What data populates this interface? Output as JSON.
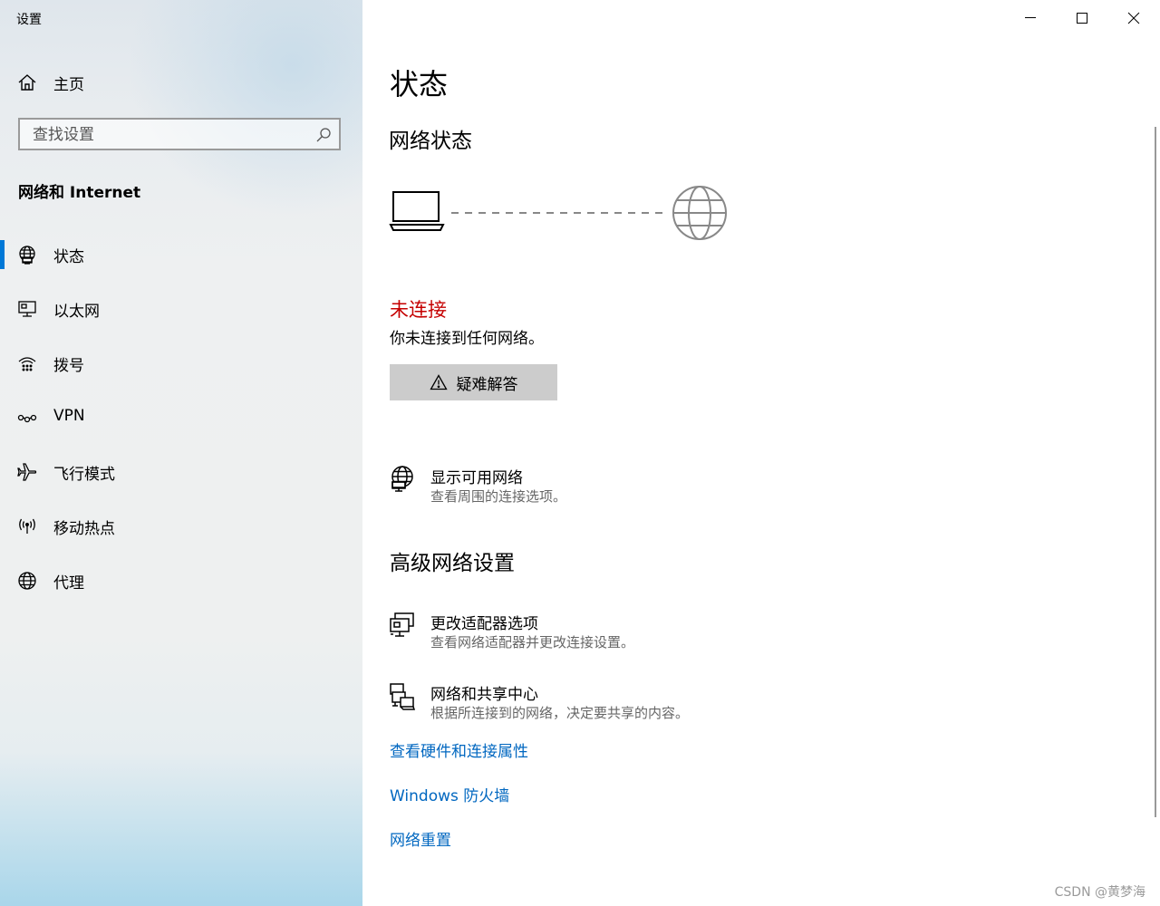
{
  "window": {
    "title": "设置"
  },
  "sidebar": {
    "home_label": "主页",
    "search_placeholder": "查找设置",
    "section_header": "网络和 Internet",
    "items": [
      {
        "label": "状态",
        "icon": "globe-status-icon",
        "active": true
      },
      {
        "label": "以太网",
        "icon": "ethernet-icon"
      },
      {
        "label": "拨号",
        "icon": "dialup-icon"
      },
      {
        "label": "VPN",
        "icon": "vpn-icon"
      },
      {
        "label": "飞行模式",
        "icon": "airplane-icon"
      },
      {
        "label": "移动热点",
        "icon": "hotspot-icon"
      },
      {
        "label": "代理",
        "icon": "globe-icon"
      }
    ]
  },
  "main": {
    "page_title": "状态",
    "network_status_heading": "网络状态",
    "status": {
      "text": "未连接",
      "color": "#c50000",
      "description": "你未连接到任何网络。"
    },
    "troubleshoot_label": "疑难解答",
    "show_networks": {
      "title": "显示可用网络",
      "subtitle": "查看周围的连接选项。"
    },
    "advanced_heading": "高级网络设置",
    "advanced_options": [
      {
        "title": "更改适配器选项",
        "subtitle": "查看网络适配器并更改连接设置。"
      },
      {
        "title": "网络和共享中心",
        "subtitle": "根据所连接到的网络，决定要共享的内容。"
      }
    ],
    "links": [
      "查看硬件和连接属性",
      "Windows 防火墙",
      "网络重置"
    ]
  },
  "accent_color": "#0078d7",
  "link_color": "#0067c0",
  "watermark": "CSDN @黄梦海"
}
